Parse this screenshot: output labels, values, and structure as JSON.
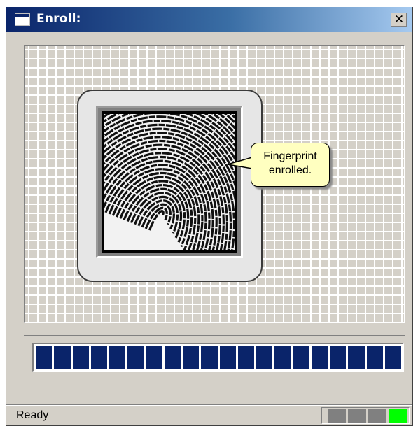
{
  "window": {
    "title": "Enroll:",
    "close_glyph": "✕",
    "title_icon": "window-icon",
    "close_icon": "close-icon"
  },
  "balloon": {
    "line1": "Fingerprint",
    "line2": "enrolled."
  },
  "progress": {
    "segments": 20,
    "filled": 20,
    "fraction": 1.0,
    "fill_color": "#0a246a"
  },
  "status": {
    "text": "Ready",
    "indicators": [
      "#808080",
      "#808080",
      "#808080",
      "#00ff00"
    ]
  },
  "colors": {
    "titlebar_start": "#0a246a",
    "titlebar_end": "#a6caf0",
    "balloon_bg": "#ffffc0",
    "window_bg": "#d4d0c8"
  }
}
